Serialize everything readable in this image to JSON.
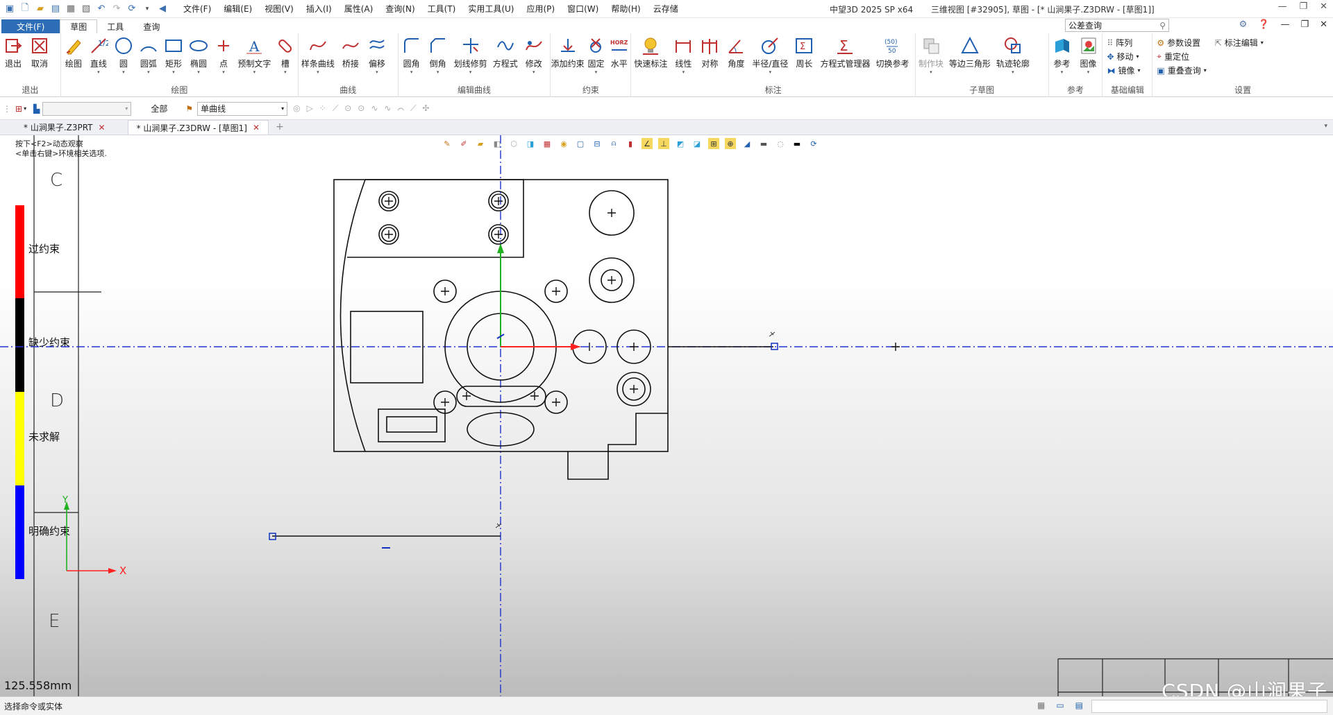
{
  "title": {
    "menus": [
      "文件(F)",
      "编辑(E)",
      "视图(V)",
      "插入(I)",
      "属性(A)",
      "查询(N)",
      "工具(T)",
      "实用工具(U)",
      "应用(P)",
      "窗口(W)",
      "帮助(H)",
      "云存储"
    ],
    "app_name": "中望3D 2025 SP x64",
    "doc_title": "三维视图 [#32905], 草图 - [* 山涧果子.Z3DRW - [草图1]]",
    "window_buttons": [
      "minimize-icon",
      "restore-icon",
      "close-icon"
    ]
  },
  "tabs": {
    "file_label": "文件(F)",
    "items": [
      "草图",
      "工具",
      "查询"
    ],
    "search_text": "公差查询"
  },
  "ribbon": {
    "exit": {
      "name": "退出",
      "tools": [
        "退出",
        "取消"
      ]
    },
    "draw": {
      "name": "绘图",
      "tools": [
        "绘图",
        "直线",
        "圆",
        "圆弧",
        "矩形",
        "椭圆",
        "点",
        "预制文字",
        "槽"
      ]
    },
    "curve": {
      "name": "曲线",
      "tools": [
        "样条曲线",
        "桥接",
        "偏移"
      ]
    },
    "edit": {
      "name": "编辑曲线",
      "tools": [
        "圆角",
        "倒角",
        "划线修剪",
        "方程式",
        "修改"
      ]
    },
    "constraint": {
      "name": "约束",
      "tools": [
        "添加约束",
        "固定",
        "水平"
      ]
    },
    "dimension": {
      "name": "标注",
      "tools": [
        "快速标注",
        "线性",
        "对称",
        "角度",
        "半径/直径",
        "周长",
        "方程式管理器",
        "切换参考"
      ]
    },
    "subsketch": {
      "name": "子草图",
      "tools": [
        "制作块",
        "等边三角形",
        "轨迹轮廓"
      ]
    },
    "reference": {
      "name": "参考",
      "tools": [
        "参考",
        "图像"
      ]
    },
    "basic_edit": {
      "name": "基础编辑",
      "items": [
        "阵列",
        "移动",
        "镜像"
      ]
    },
    "settings": {
      "name": "设置",
      "items": [
        "参数设置",
        "重定位",
        "重叠查询",
        "标注编辑"
      ]
    }
  },
  "toolbar2": {
    "filter_label": "全部",
    "curve_type": "单曲线"
  },
  "doc_tabs": [
    "* 山涧果子.Z3PRT",
    "* 山涧果子.Z3DRW - [草图1]"
  ],
  "canvas": {
    "hint_line1": "按下<F2>动态观察",
    "hint_line2": "<单击右键>环境相关选项.",
    "legend": [
      {
        "label": "过约束",
        "color": "#ff0000"
      },
      {
        "label": "缺少约束",
        "color": "#000000"
      },
      {
        "label": "未求解",
        "color": "#ffff00"
      },
      {
        "label": "明确约束",
        "color": "#0000ff"
      }
    ],
    "letters": [
      "C",
      "D",
      "E"
    ],
    "axis_x": "X",
    "axis_y": "Y",
    "measure": "125.558mm",
    "watermark": "CSDN @山涧果子"
  },
  "status": {
    "prompt": "选择命令或实体"
  }
}
